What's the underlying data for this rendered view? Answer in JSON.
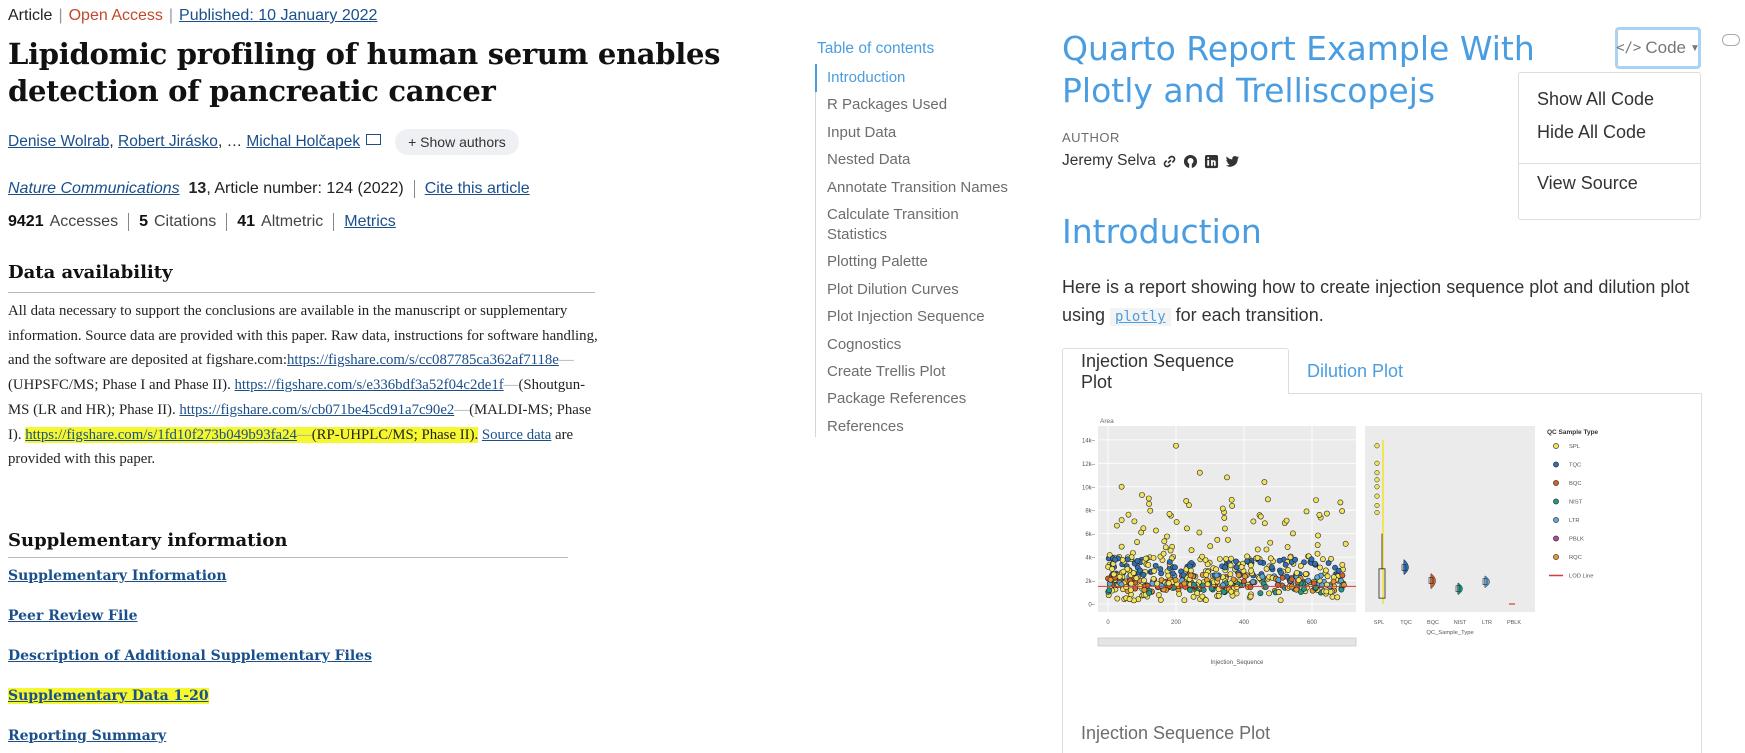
{
  "article": {
    "type": "Article",
    "access": "Open Access",
    "published": "Published: 10 January 2022",
    "title": "Lipidomic profiling of human serum enables detection of pancreatic cancer",
    "authors": [
      "Denise Wolrab",
      "Robert Jirásko",
      "Michal Holčapek"
    ],
    "authors_ellipsis": "…",
    "show_authors": "Show authors",
    "journal": "Nature Communications",
    "volume": "13",
    "article_number": ", Article number: 124 (2022)",
    "cite": "Cite this article",
    "accesses_count": "9421",
    "accesses_label": "Accesses",
    "citations_count": "5",
    "citations_label": "Citations",
    "altmetric_count": "41",
    "altmetric_label": "Altmetric",
    "metrics_link": "Metrics",
    "data_availability_heading": "Data availability",
    "da_text_1": "All data necessary to support the conclusions are available in the manuscript or supplementary information. Source data are provided with this paper. Raw data, instructions for software handling, and the software are deposited at figshare.com:",
    "da_link_1": "https://figshare.com/s/cc087785ca362af7118e",
    "da_text_2": "(UHPSFC/MS; Phase I and Phase II). ",
    "da_link_2": "https://figshare.com/s/e336bdf3a52f04c2de1f",
    "da_text_3": "(Shoutgun-MS (LR and HR); Phase II). ",
    "da_link_3": "https://figshare.com/s/cb071be45cd91a7c90e2",
    "da_text_4": "(MALDI-MS; Phase I). ",
    "da_link_4": "https://figshare.com/s/1fd10f273b049b93fa24",
    "da_text_5": "(RP-UHPLC/MS; Phase II).",
    "da_source_link": "Source data",
    "da_text_6": " are provided with this paper.",
    "dash": "—",
    "supp_heading": "Supplementary information",
    "supp_links": [
      "Supplementary Information",
      "Peer Review File",
      "Description of Additional Supplementary Files",
      "Supplementary Data 1-20",
      "Reporting Summary"
    ]
  },
  "toc": {
    "title": "Table of contents",
    "items": [
      "Introduction",
      "R Packages Used",
      "Input Data",
      "Nested Data",
      "Annotate Transition Names",
      "Calculate Transition Statistics",
      "Plotting Palette",
      "Plot Dilution Curves",
      "Plot Injection Sequence",
      "Cognostics",
      "Create Trellis Plot",
      "Package References",
      "References"
    ]
  },
  "report": {
    "title": "Quarto Report Example With Plotly and Trelliscopejs",
    "author_label": "AUTHOR",
    "author_name": "Jeremy Selva",
    "intro_heading": "Introduction",
    "intro_text_1": "Here is a report showing how to create injection sequence plot and dilution plot using ",
    "intro_code": "plotly",
    "intro_text_2": " for each transition.",
    "code_button": "Code",
    "code_menu": [
      "Show All Code",
      "Hide All Code",
      "View Source"
    ],
    "tabs": [
      "Injection Sequence Plot",
      "Dilution Plot"
    ],
    "panel_caption": "Injection Sequence Plot"
  },
  "colors": {
    "accent": "#4a9de0",
    "link": "#1a4f8b",
    "highlight": "#f5f730",
    "open_access": "#c0492b"
  },
  "chart_data": [
    {
      "type": "scatter",
      "title": "",
      "ylabel": "Area",
      "xlabel": "Injection_Sequence",
      "x_ticks": [
        "0",
        "200",
        "400",
        "600"
      ],
      "y_ticks": [
        "0",
        "2k",
        "4k",
        "6k",
        "8k",
        "10k",
        "12k",
        "14k"
      ],
      "xlim": [
        0,
        700
      ],
      "ylim": [
        0,
        14500
      ],
      "grid": true,
      "note": "dense scatter of ~700 injections; most points between 0 and 4k, outliers up to ~13.5k",
      "series": [
        {
          "name": "SPL",
          "color": "#f2e35c"
        },
        {
          "name": "TQC",
          "color": "#2f6fb4"
        },
        {
          "name": "BQC",
          "color": "#d4602b"
        },
        {
          "name": "NIST",
          "color": "#1d9a8a"
        },
        {
          "name": "LTR",
          "color": "#5da9e0"
        },
        {
          "name": "PBLK",
          "color": "#b04a9a"
        },
        {
          "name": "RQC",
          "color": "#e59b2d"
        }
      ]
    },
    {
      "type": "violin",
      "xlabel": "QC_Sample_Type",
      "categories": [
        "SPL",
        "TQC",
        "BQC",
        "NIST",
        "LTR",
        "PBLK"
      ],
      "legend_title": "QC Sample Type",
      "legend_entries": [
        "SPL",
        "TQC",
        "BQC",
        "NIST",
        "LTR",
        "PBLK",
        "RQC",
        "LOD Line"
      ],
      "legend_placement": "right"
    }
  ]
}
